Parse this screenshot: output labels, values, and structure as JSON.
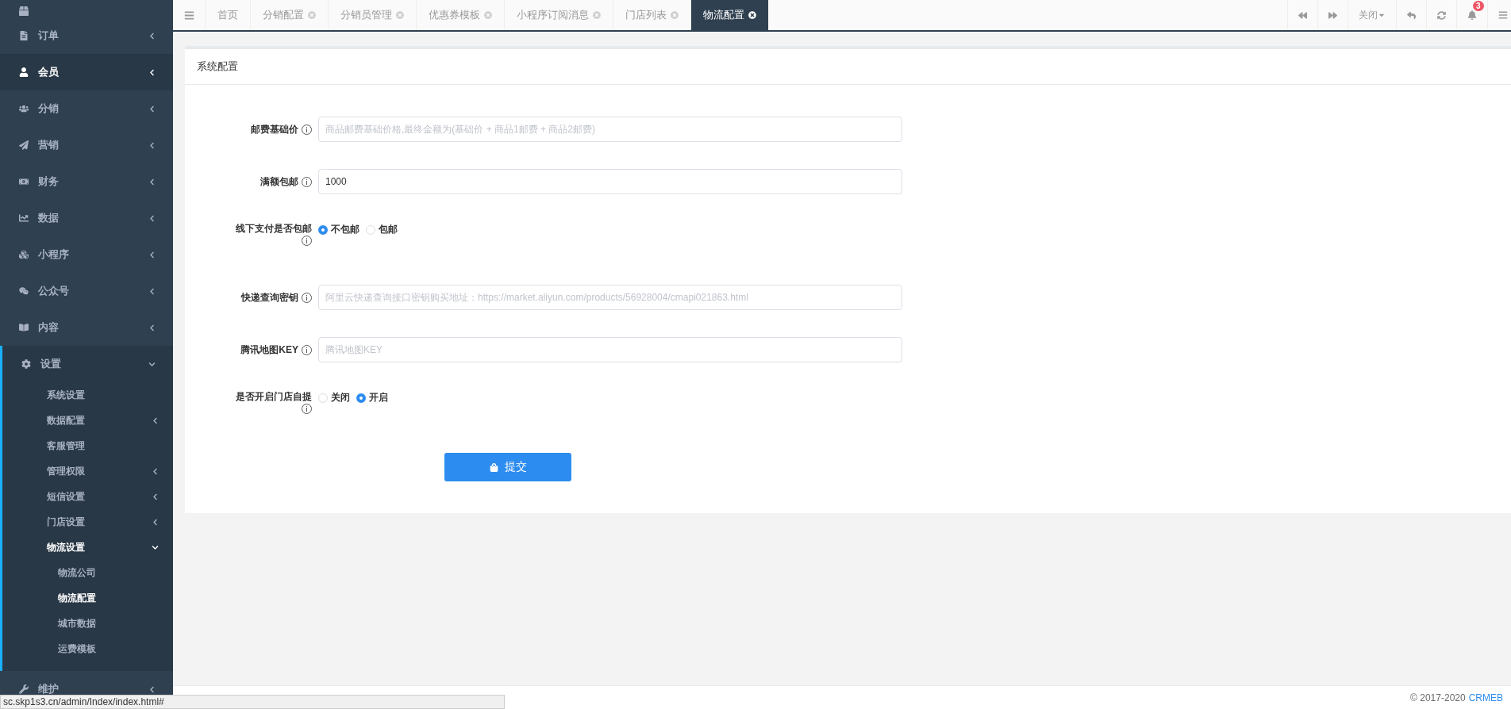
{
  "sidebar": {
    "items": [
      {
        "label": "订单",
        "selected": false,
        "expanded": false
      },
      {
        "label": "会员",
        "selected": true,
        "expanded": false
      },
      {
        "label": "分销",
        "selected": false,
        "expanded": false
      },
      {
        "label": "营销",
        "selected": false,
        "expanded": false
      },
      {
        "label": "财务",
        "selected": false,
        "expanded": false
      },
      {
        "label": "数据",
        "selected": false,
        "expanded": false
      },
      {
        "label": "小程序",
        "selected": false,
        "expanded": false
      },
      {
        "label": "公众号",
        "selected": false,
        "expanded": false
      },
      {
        "label": "内容",
        "selected": false,
        "expanded": false
      },
      {
        "label": "设置",
        "selected": false,
        "expanded": true,
        "children": [
          {
            "label": "系统设置",
            "selected": false
          },
          {
            "label": "数据配置",
            "selected": false,
            "expanded": false
          },
          {
            "label": "客服管理",
            "selected": false
          },
          {
            "label": "管理权限",
            "selected": false,
            "expanded": false
          },
          {
            "label": "短信设置",
            "selected": false,
            "expanded": false
          },
          {
            "label": "门店设置",
            "selected": false,
            "expanded": false
          },
          {
            "label": "物流设置",
            "selected": true,
            "expanded": true,
            "children": [
              {
                "label": "物流公司",
                "selected": false
              },
              {
                "label": "物流配置",
                "selected": true
              },
              {
                "label": "城市数据",
                "selected": false
              },
              {
                "label": "运费模板",
                "selected": false
              }
            ]
          }
        ]
      },
      {
        "label": "维护",
        "selected": false,
        "expanded": false
      }
    ]
  },
  "tabs": [
    {
      "label": "首页",
      "selected": false,
      "closable": false
    },
    {
      "label": "分销配置",
      "selected": false,
      "closable": true
    },
    {
      "label": "分销员管理",
      "selected": false,
      "closable": true
    },
    {
      "label": "优惠券模板",
      "selected": false,
      "closable": true
    },
    {
      "label": "小程序订阅消息",
      "selected": false,
      "closable": true
    },
    {
      "label": "门店列表",
      "selected": false,
      "closable": true
    },
    {
      "label": "物流配置",
      "selected": true,
      "closable": true
    }
  ],
  "toolbar": {
    "close_label": "关闭",
    "notification_count": "3"
  },
  "card": {
    "title": "系统配置",
    "fields": [
      {
        "kind": "input",
        "label": "邮费基础价",
        "placeholder": "商品邮费基础价格,最终金额为(基础价 + 商品1邮费 + 商品2邮费)"
      },
      {
        "kind": "input",
        "label": "满额包邮",
        "value": "1000"
      },
      {
        "kind": "radio",
        "label": "线下支付是否包邮",
        "options": [
          {
            "label": "不包邮",
            "selected": true
          },
          {
            "label": "包邮",
            "selected": false
          }
        ]
      },
      {
        "kind": "input",
        "label": "快递查询密钥",
        "placeholder": "阿里云快递查询接口密钥购买地址：https://market.aliyun.com/products/56928004/cmapi021863.html"
      },
      {
        "kind": "input",
        "label": "腾讯地图KEY",
        "placeholder": "腾讯地图KEY"
      },
      {
        "kind": "radio",
        "label": "是否开启门店自提",
        "options": [
          {
            "label": "关闭",
            "selected": false
          },
          {
            "label": "开启",
            "selected": true
          }
        ]
      }
    ],
    "submit": "提交"
  },
  "footer": {
    "copyright": "© 2017-2020",
    "brand": "CRMEB"
  },
  "status_url": "sc.skp1s3.cn/admin/Index/index.html#"
}
